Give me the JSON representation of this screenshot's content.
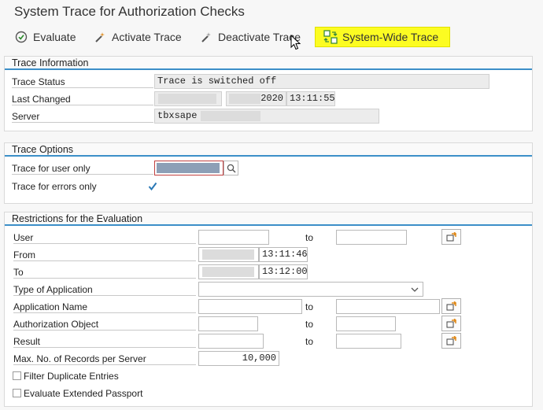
{
  "window": {
    "title": "System Trace for Authorization Checks"
  },
  "toolbar": {
    "evaluate": "Evaluate",
    "activate": "Activate Trace",
    "deactivate": "Deactivate Trace",
    "system_wide": "System-Wide Trace",
    "highlight_color": "#fcfc22"
  },
  "trace_info": {
    "header": "Trace Information",
    "status_label": "Trace Status",
    "status_value": "Trace is switched off",
    "last_changed_label": "Last Changed",
    "last_changed_date": "2020",
    "last_changed_time": "13:11:55",
    "server_label": "Server",
    "server_value": "tbxsape"
  },
  "trace_options": {
    "header": "Trace Options",
    "user_only_label": "Trace for user only",
    "errors_only_label": "Trace for errors only",
    "errors_only_checked": true
  },
  "restrictions": {
    "header": "Restrictions for the Evaluation",
    "to_label": "to",
    "user_label": "User",
    "from_label": "From",
    "from_time": "13:11:46",
    "to_row_label": "To",
    "to_time": "13:12:00",
    "type_label": "Type of Application",
    "app_name_label": "Application Name",
    "auth_object_label": "Authorization Object",
    "result_label": "Result",
    "max_records_label": "Max. No. of Records per Server",
    "max_records_value": "10,000",
    "filter_dup_label": "Filter Duplicate Entries",
    "eval_passport_label": "Evaluate Extended Passport"
  },
  "colors": {
    "accent": "#3c8fc8",
    "check": "#2a78b5"
  }
}
